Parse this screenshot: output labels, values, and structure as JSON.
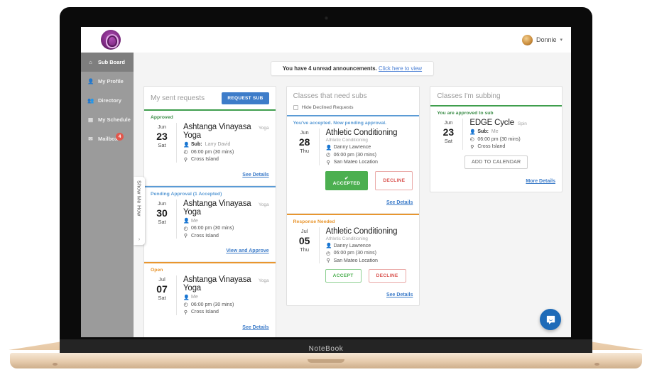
{
  "device": {
    "label": "NoteBook"
  },
  "topbar": {
    "logo_icon": "panther-logo",
    "user_name": "Donnie",
    "caret_icon": "chevron-down-icon"
  },
  "sidebar": {
    "items": [
      {
        "label": "Sub Board",
        "icon": "home-icon",
        "active": true,
        "badge": ""
      },
      {
        "label": "My Profile",
        "icon": "user-icon",
        "active": false,
        "badge": ""
      },
      {
        "label": "Directory",
        "icon": "people-icon",
        "active": false,
        "badge": ""
      },
      {
        "label": "My Schedule",
        "icon": "calendar-icon",
        "active": false,
        "badge": ""
      },
      {
        "label": "Mailbox",
        "icon": "envelope-icon",
        "active": false,
        "badge": "4"
      }
    ],
    "show_me_how": {
      "label": "Show Me How",
      "arrow": "›"
    }
  },
  "announcement": {
    "text": "You have 4 unread announcements.",
    "link": "Click here to view"
  },
  "columns": {
    "sent_requests": {
      "title": "My sent requests",
      "request_sub_label": "REQUEST SUB",
      "cards": [
        {
          "status": "Approved",
          "status_color": "#3f8f4b",
          "month": "Jun",
          "day": "23",
          "dow": "Sat",
          "class_name": "Ashtanga Vinayasa Yoga",
          "class_tag": "Yoga",
          "sub_label": "Sub:",
          "sub_name": "Larry David",
          "time": "06:00 pm (30 mins)",
          "location": "Cross Island",
          "link": "See Details"
        },
        {
          "status": "Pending Approval (1 Accepted)",
          "status_color": "#5b9bd5",
          "month": "Jun",
          "day": "30",
          "dow": "Sat",
          "class_name": "Ashtanga Vinayasa Yoga",
          "class_tag": "Yoga",
          "sub_label": "",
          "sub_name": "Me",
          "time": "06:00 pm (30 mins)",
          "location": "Cross Island",
          "link": "View and Approve"
        },
        {
          "status": "Open",
          "status_color": "#e8962f",
          "month": "Jul",
          "day": "07",
          "dow": "Sat",
          "class_name": "Ashtanga Vinayasa Yoga",
          "class_tag": "Yoga",
          "sub_label": "",
          "sub_name": "Me",
          "time": "06:00 pm (30 mins)",
          "location": "Cross Island",
          "link": "See Details"
        }
      ]
    },
    "need_subs": {
      "title": "Classes that need subs",
      "hide_declined_label": "Hide Declined Requests",
      "cards": [
        {
          "status": "You've accepted. Now pending approval.",
          "status_color": "#5b9bd5",
          "month": "Jun",
          "day": "28",
          "dow": "Thu",
          "class_name": "Athletic Conditioning",
          "class_sub": "Athletic Conditioning",
          "person": "Danny Lawrence",
          "time": "06:00 pm (30 mins)",
          "location": "San Mateo Location",
          "primary_btn": "✔ ACCEPTED",
          "secondary_btn": "DECLINE",
          "link": "See Details"
        },
        {
          "status": "Response Needed",
          "status_color": "#e8962f",
          "month": "Jul",
          "day": "05",
          "dow": "Thu",
          "class_name": "Athletic Conditioning",
          "class_sub": "Athletic Conditioning",
          "person": "Danny Lawrence",
          "time": "06:00 pm (30 mins)",
          "location": "San Mateo Location",
          "primary_btn": "ACCEPT",
          "secondary_btn": "DECLINE",
          "link": "See Details"
        }
      ]
    },
    "subbing": {
      "title": "Classes I'm subbing",
      "cards": [
        {
          "status": "You are approved to sub",
          "status_color": "#3f8f4b",
          "month": "Jun",
          "day": "23",
          "dow": "Sat",
          "class_name": "EDGE Cycle",
          "class_tag": "Spin",
          "sub_label": "Sub:",
          "sub_name": "Me",
          "time": "06:00 pm (30 mins)",
          "location": "Cross Island",
          "calendar_btn": "ADD TO CALENDAR",
          "link": "More Details"
        }
      ]
    }
  },
  "widgets": {
    "intercom_icon": "chat-bubble-icon"
  },
  "colors": {
    "accent_blue": "#3d7cc9",
    "green": "#4caf50",
    "orange": "#e8962f",
    "red": "#d9534f",
    "sidebar": "#9b9b9b"
  }
}
